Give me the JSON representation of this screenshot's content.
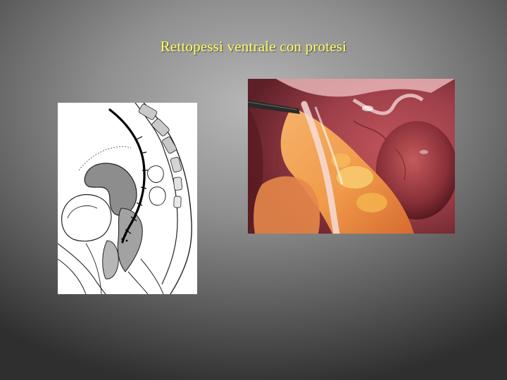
{
  "slide": {
    "title": "Rettopessi ventrale con protesi"
  },
  "figures": {
    "left": {
      "icon": "anatomical-sagittal-pelvis-diagram"
    },
    "right": {
      "icon": "laparoscopic-photo"
    }
  },
  "colors": {
    "title": "#ffff66",
    "background_center": "#b7b7b7",
    "background_edge": "#2f2f2f"
  }
}
